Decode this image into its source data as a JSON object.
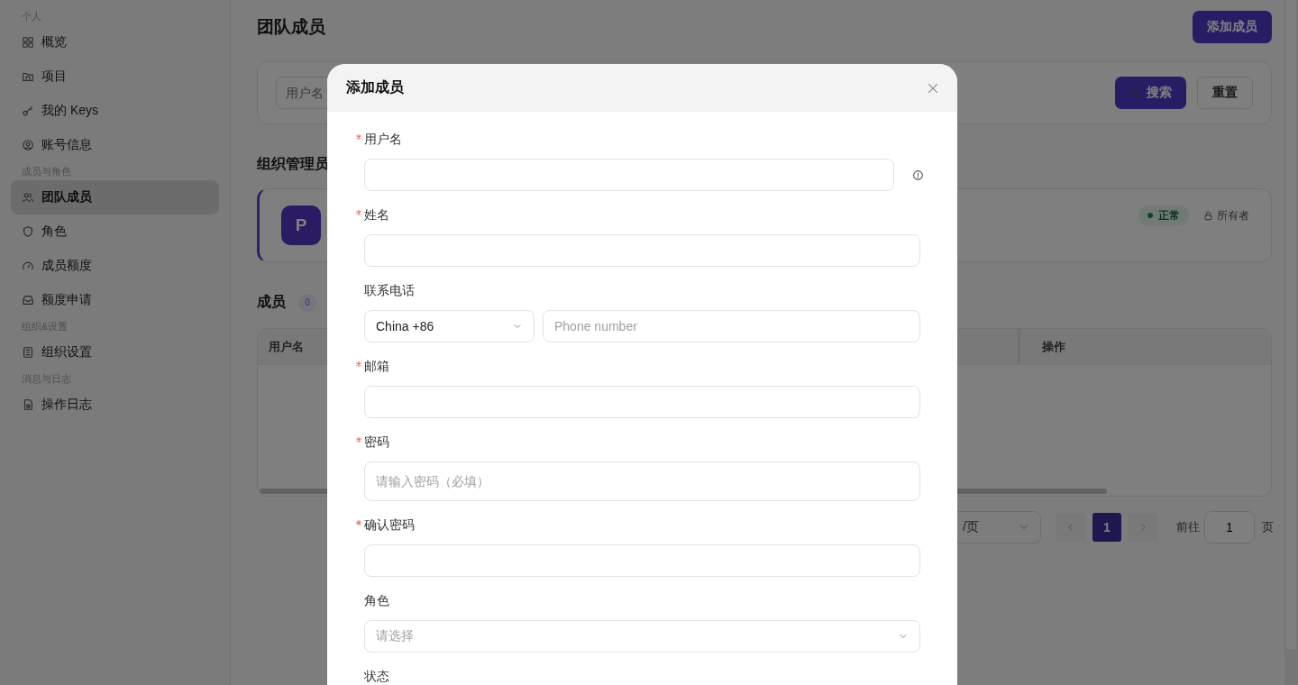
{
  "sidebar": {
    "sections": [
      {
        "title": "个人",
        "items": [
          {
            "label": "概览",
            "selected": false
          },
          {
            "label": "项目",
            "selected": false
          },
          {
            "label": "我的 Keys",
            "selected": false
          },
          {
            "label": "账号信息",
            "selected": false
          }
        ]
      },
      {
        "title": "成员与角色",
        "items": [
          {
            "label": "团队成员",
            "selected": true
          },
          {
            "label": "角色",
            "selected": false
          },
          {
            "label": "成员额度",
            "selected": false
          },
          {
            "label": "额度申请",
            "selected": false
          }
        ]
      },
      {
        "title": "组织&设置",
        "items": [
          {
            "label": "组织设置",
            "selected": false
          }
        ]
      },
      {
        "title": "消息与日志",
        "items": [
          {
            "label": "操作日志",
            "selected": false
          }
        ]
      }
    ]
  },
  "page": {
    "title": "团队成员",
    "add_button": "添加成员",
    "search": {
      "placeholder": "用户名",
      "search_button": "搜索",
      "reset_button": "重置"
    },
    "admins": {
      "heading": "组织管理员",
      "card": {
        "avatar": "P",
        "status": "正常",
        "role": "所有者"
      }
    },
    "members": {
      "heading": "成员",
      "count": "0",
      "table": {
        "columns": [
          "用户名",
          "操作"
        ]
      }
    },
    "pagination": {
      "page_size": "/页",
      "pages": [
        {
          "label": "1",
          "selected": true
        }
      ],
      "goto_label": "前往",
      "goto_value": "1",
      "page_unit": "页"
    }
  },
  "modal": {
    "title": "添加成员",
    "fields": [
      {
        "label": "用户名",
        "required": true,
        "kind": "text",
        "info": true
      },
      {
        "label": "姓名",
        "required": true,
        "kind": "text",
        "info": false
      },
      {
        "label": "联系电话",
        "required": false,
        "kind": "phone",
        "info": false,
        "country": "China +86",
        "placeholder": "Phone number"
      },
      {
        "label": "邮箱",
        "required": true,
        "kind": "text",
        "info": false
      },
      {
        "label": "密码",
        "required": true,
        "kind": "password",
        "info": false,
        "placeholder": "请输入密码（必填）"
      },
      {
        "label": "确认密码",
        "required": true,
        "kind": "text",
        "info": false
      },
      {
        "label": "角色",
        "required": false,
        "kind": "select",
        "info": false,
        "placeholder": "请选择"
      },
      {
        "label": "状态",
        "required": false,
        "kind": "cut",
        "info": false
      }
    ]
  }
}
